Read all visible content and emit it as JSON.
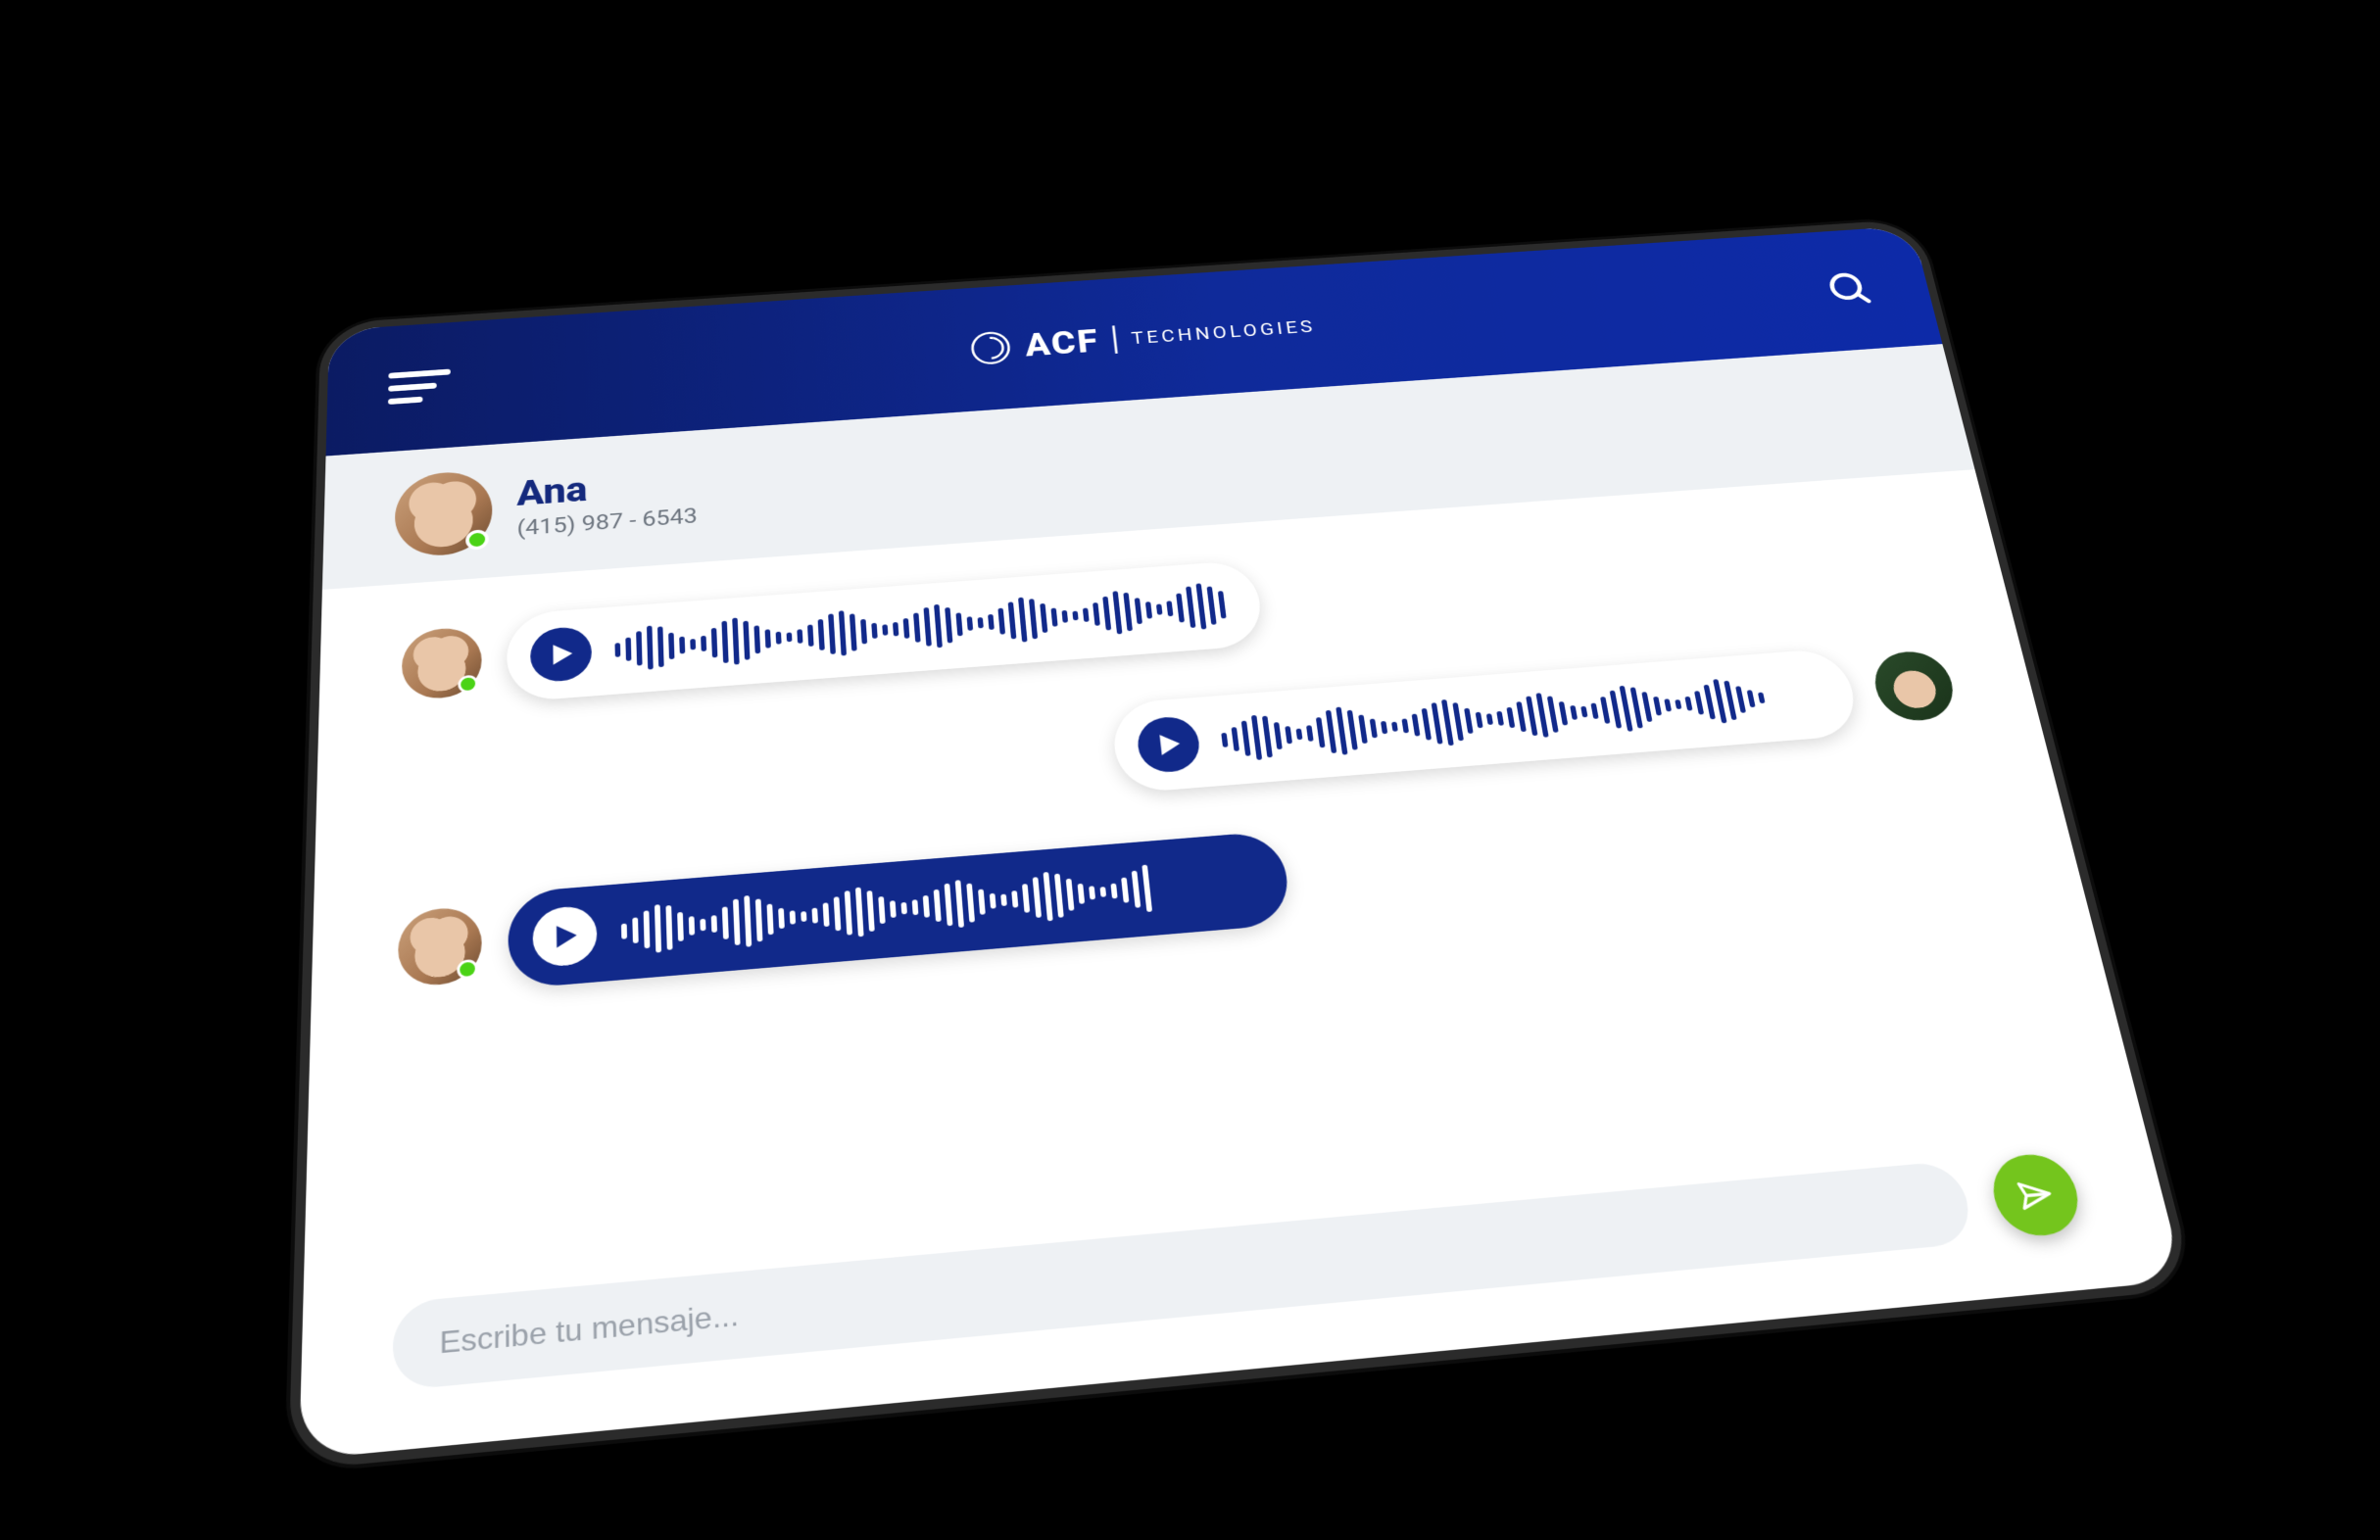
{
  "header": {
    "brand_main": "ACF",
    "brand_sub": "TECHNOLOGIES"
  },
  "contact": {
    "name": "Ana",
    "phone": "(415) 987 - 6543"
  },
  "messages": [
    {
      "from": "ana",
      "type": "voice",
      "style": "light",
      "bars": 58
    },
    {
      "from": "agent",
      "type": "voice",
      "style": "light",
      "bars": 52
    },
    {
      "from": "ana",
      "type": "voice",
      "style": "dark",
      "bars": 48
    }
  ],
  "composer": {
    "placeholder": "Escribe tu mensaje..."
  },
  "colors": {
    "brand_blue": "#11298a",
    "header_gradient_from": "#0b1b63",
    "header_gradient_to": "#0d2aa8",
    "send_green": "#74c51d",
    "status_green": "#4bd316"
  }
}
